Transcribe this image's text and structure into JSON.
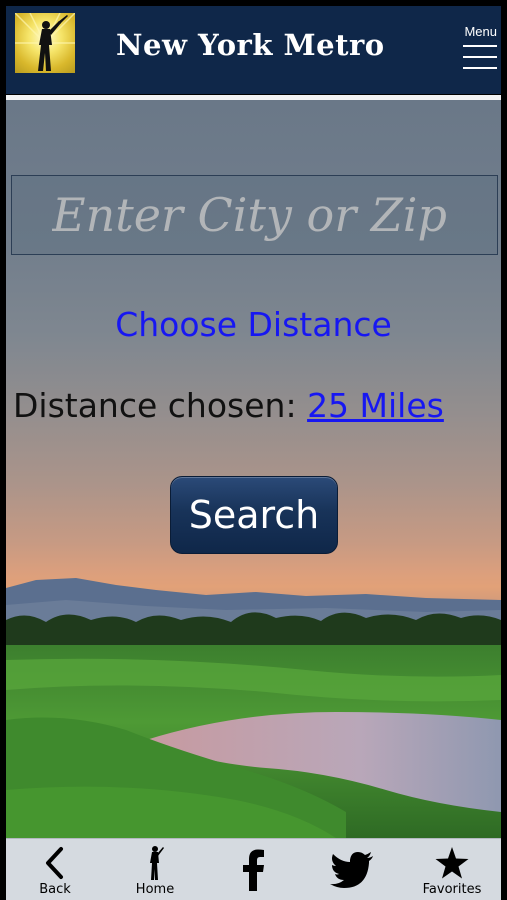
{
  "header": {
    "title": "New York Metro",
    "menu_label": "Menu",
    "logo_icon": "golfer-logo-icon"
  },
  "search": {
    "placeholder": "Enter City or Zip",
    "value": ""
  },
  "distance": {
    "choose_label": "Choose Distance",
    "chosen_prefix": "Distance chosen:",
    "chosen_value": "25 Miles"
  },
  "actions": {
    "search_label": "Search"
  },
  "bottom_nav": {
    "items": [
      {
        "label": "Back",
        "icon": "back-chevron-icon"
      },
      {
        "label": "Home",
        "icon": "golfer-icon"
      },
      {
        "label": "",
        "icon": "facebook-icon"
      },
      {
        "label": "",
        "icon": "twitter-icon"
      },
      {
        "label": "Favorites",
        "icon": "star-icon"
      }
    ]
  },
  "colors": {
    "header_bg": "#0f2749",
    "link_blue": "#1717f2",
    "bottom_bar_bg": "#d5dae0"
  }
}
